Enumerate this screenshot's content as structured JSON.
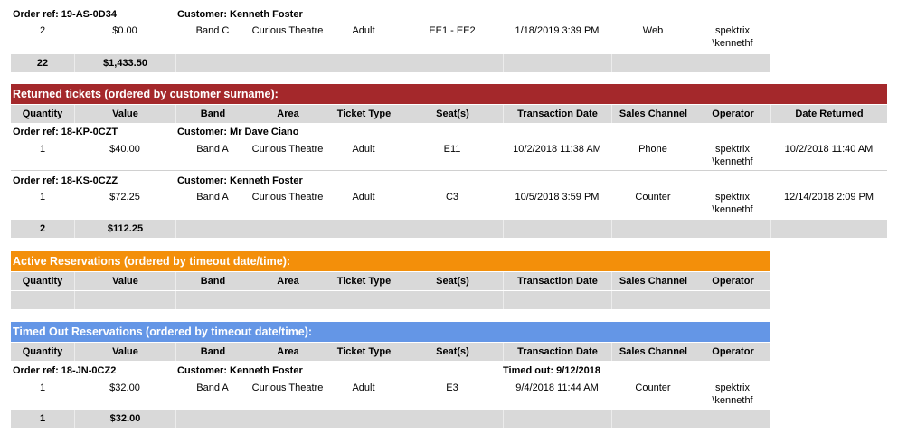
{
  "colors": {
    "returned": "#a4282b",
    "active": "#f38f0a",
    "timedout": "#6496e6",
    "grey": "#d9d9d9"
  },
  "top": {
    "order_ref": "Order ref: 19-AS-0D34",
    "customer": "Customer: Kenneth Foster",
    "row": {
      "qty": "2",
      "value": "$0.00",
      "band": "Band C",
      "area": "Curious Theatre",
      "type": "Adult",
      "seats": "EE1 - EE2",
      "date": "1/18/2019 3:39 PM",
      "channel": "Web",
      "op1": "spektrix",
      "op2": "\\kennethf"
    },
    "total_qty": "22",
    "total_value": "$1,433.50"
  },
  "headers": {
    "quantity": "Quantity",
    "value": "Value",
    "band": "Band",
    "area": "Area",
    "type": "Ticket Type",
    "seats": "Seat(s)",
    "date": "Transaction Date",
    "channel": "Sales Channel",
    "operator": "Operator",
    "returned": "Date Returned"
  },
  "returned": {
    "title": "Returned tickets (ordered by customer surname):",
    "orders": [
      {
        "ref": "Order ref: 18-KP-0CZT",
        "customer": "Customer: Mr Dave Ciano",
        "qty": "1",
        "value": "$40.00",
        "band": "Band A",
        "area": "Curious Theatre",
        "type": "Adult",
        "seats": "E11",
        "date": "10/2/2018 11:38 AM",
        "channel": "Phone",
        "op1": "spektrix",
        "op2": "\\kennethf",
        "returned": "10/2/2018 11:40 AM"
      },
      {
        "ref": "Order ref: 18-KS-0CZZ",
        "customer": "Customer: Kenneth Foster",
        "qty": "1",
        "value": "$72.25",
        "band": "Band A",
        "area": "Curious Theatre",
        "type": "Adult",
        "seats": "C3",
        "date": "10/5/2018 3:59 PM",
        "channel": "Counter",
        "op1": "spektrix",
        "op2": "\\kennethf",
        "returned": "12/14/2018 2:09 PM"
      }
    ],
    "total_qty": "2",
    "total_value": "$112.25"
  },
  "active": {
    "title": "Active Reservations (ordered by timeout date/time):"
  },
  "timedout": {
    "title": "Timed Out Reservations (ordered by timeout date/time):",
    "ref": "Order ref: 18-JN-0CZ2",
    "customer": "Customer: Kenneth Foster",
    "timed_out": "Timed out: 9/12/2018",
    "row": {
      "qty": "1",
      "value": "$32.00",
      "band": "Band A",
      "area": "Curious Theatre",
      "type": "Adult",
      "seats": "E3",
      "date": "9/4/2018 11:44 AM",
      "channel": "Counter",
      "op1": "spektrix",
      "op2": "\\kennethf"
    },
    "total_qty": "1",
    "total_value": "$32.00"
  }
}
